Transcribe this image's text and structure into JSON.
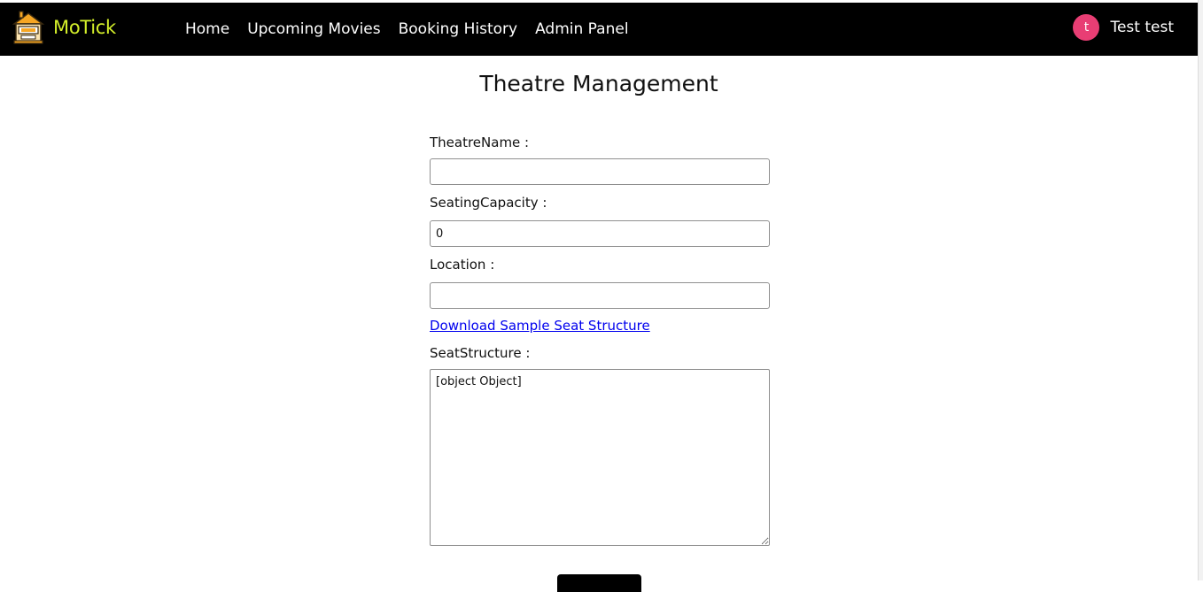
{
  "brand": {
    "name": "MoTick",
    "logo_icon": "ticket-booth-icon",
    "accent_color": "#d4ef2a"
  },
  "nav": {
    "links": [
      {
        "label": "Home"
      },
      {
        "label": "Upcoming Movies"
      },
      {
        "label": "Booking History"
      },
      {
        "label": "Admin Panel"
      }
    ]
  },
  "user": {
    "initial": "t",
    "name": "Test test",
    "avatar_color": "#e83e74"
  },
  "page": {
    "title": "Theatre Management"
  },
  "form": {
    "theatre_name": {
      "label": "TheatreName :",
      "value": ""
    },
    "seating_capacity": {
      "label": "SeatingCapacity :",
      "value": "0"
    },
    "location": {
      "label": "Location :",
      "value": ""
    },
    "download_link": "Download Sample Seat Structure",
    "seat_structure": {
      "label": "SeatStructure :",
      "value": "[object Object]"
    }
  }
}
